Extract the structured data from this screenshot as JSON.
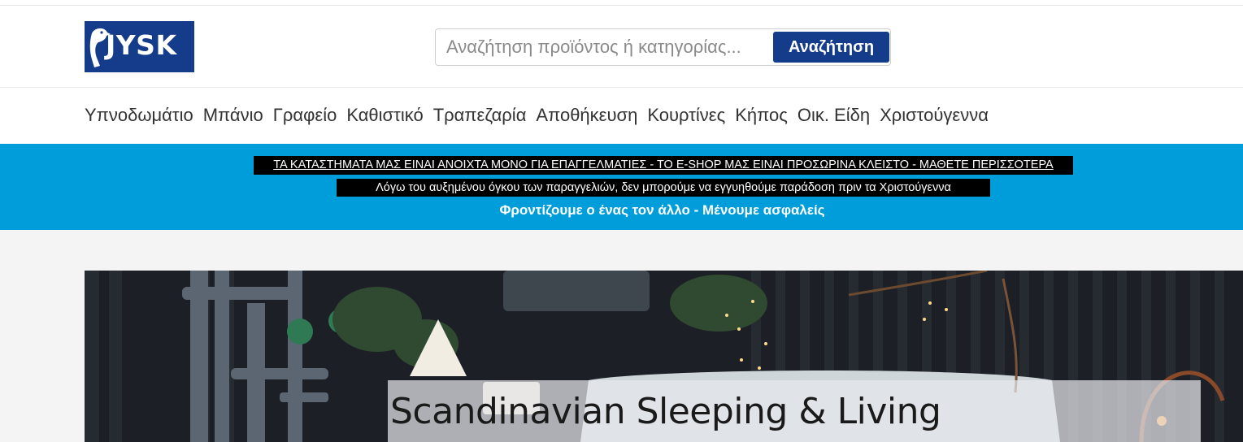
{
  "brand": {
    "logo_text": "JYSK",
    "color": "#143c8a"
  },
  "search": {
    "placeholder": "Αναζήτηση προϊόντος ή κατηγορίας...",
    "button_label": "Αναζήτηση",
    "icon": "search-icon"
  },
  "nav": {
    "items": [
      {
        "label": "Υπνοδωμάτιο"
      },
      {
        "label": "Μπάνιο"
      },
      {
        "label": "Γραφείο"
      },
      {
        "label": "Καθιστικό"
      },
      {
        "label": "Τραπεζαρία"
      },
      {
        "label": "Αποθήκευση"
      },
      {
        "label": "Κουρτίνες"
      },
      {
        "label": "Κήπος"
      },
      {
        "label": "Οικ. Είδη"
      },
      {
        "label": "Χριστούγεννα"
      }
    ]
  },
  "banner": {
    "background": "#009ddb",
    "line1": "ΤΑ ΚΑΤΑΣΤΗΜΑΤΑ ΜΑΣ ΕΙΝΑΙ ΑΝΟΙΧΤΑ ΜΟΝΟ ΓΙΑ ΕΠΑΓΓΕΛΜΑΤΙΕΣ - ΤΟ E-SHOP ΜΑΣ ΕΙΝΑΙ ΠΡΟΣΩΡΙΝΑ ΚΛΕΙΣΤΟ - ΜΑΘΕΤΕ ΠΕΡΙΣΣΟΤΕΡΑ",
    "line2": "Λόγω του αυξημένου όγκου των παραγγελιών, δεν μπορούμε να εγγυηθούμε παράδοση πριν τα Χριστούγεννα",
    "line3": "Φροντίζουμε ο ένας τον άλλο - Μένουμε ασφαλείς"
  },
  "hero": {
    "title": "Scandinavian Sleeping & Living"
  }
}
